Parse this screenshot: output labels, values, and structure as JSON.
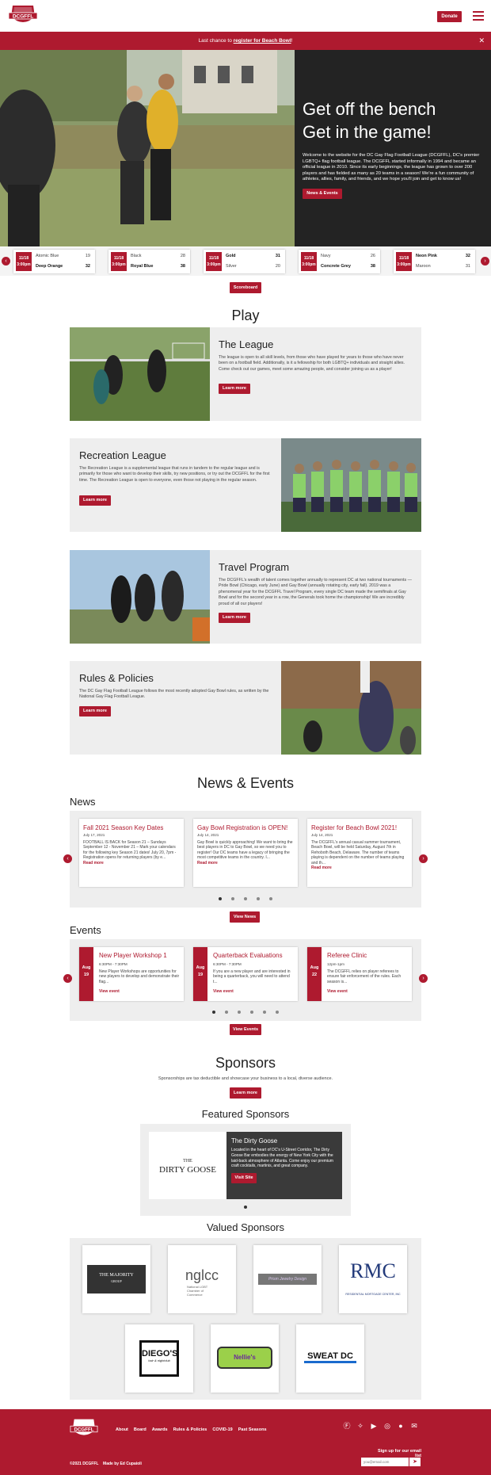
{
  "header": {
    "logo_text": "DCGFFL",
    "donate_label": "Donate"
  },
  "alert": {
    "prefix": "Last chance to ",
    "link": "register for Beach Bowl",
    "suffix": "!"
  },
  "hero": {
    "line1": "Get off the bench",
    "line2": "Get in the game!",
    "body": "Welcome to the website for the DC Gay Flag Football League (DCGFFL), DC's premier LGBTQ+ flag football league. The DCGFFL started informally in 1994 and became an official league in 2010. Since its early beginnings, the league has grown to over 200 players and has fielded as many as 20 teams in a season! We're a fun community of athletes, allies, family, and friends, and we hope you'll join and get to know us!",
    "button": "News & Events"
  },
  "scores": [
    {
      "date": "11/18",
      "time": "3:00pm",
      "t1": "Atomic Blue",
      "s1": "19",
      "t2": "Deep Orange",
      "s2": "32",
      "w": 2
    },
    {
      "date": "11/18",
      "time": "3:00pm",
      "t1": "Black",
      "s1": "28",
      "t2": "Royal Blue",
      "s2": "38",
      "w": 2
    },
    {
      "date": "11/18",
      "time": "3:00pm",
      "t1": "Gold",
      "s1": "31",
      "t2": "Silver",
      "s2": "20",
      "w": 1
    },
    {
      "date": "11/18",
      "time": "3:00pm",
      "t1": "Navy",
      "s1": "26",
      "t2": "Concrete Grey",
      "s2": "38",
      "w": 2
    },
    {
      "date": "11/18",
      "time": "3:00pm",
      "t1": "Neon Pink",
      "s1": "32",
      "t2": "Maroon",
      "s2": "31",
      "w": 1
    }
  ],
  "scoreboard_button": "Scoreboard",
  "play": {
    "title": "Play",
    "cards": [
      {
        "title": "The League",
        "body": "The league is open to all skill levels, from those who have played for years to those who have never been on a football field. Additionally, is it a fellowship for both LGBTQ+ individuals and straight allies. Come check out our games, meet some amazing people, and consider joining us as a player!",
        "button": "Learn more"
      },
      {
        "title": "Recreation League",
        "body": "The Recreation League is a supplemental league that runs in tandem to the regular league and is primarily for those who want to develop their skills, try new positions, or try out the DCGFFL for the first time. The Recreation League is open to everyone, even those not playing in the regular season.",
        "button": "Learn more"
      },
      {
        "title": "Travel Program",
        "body": "The DCGFFL's wealth of talent comes together annually to represent DC at two national tournaments — Pride Bowl (Chicago, early June) and Gay Bowl (annually rotating city, early fall). 2019 was a phenomenal year for the DCGFFL Travel Program, every single DC team made the semifinals at Gay Bowl and for the second year in a row, the Generals took home the championship! We are incredibly proud of all our players!",
        "button": "Learn more"
      },
      {
        "title": "Rules & Policies",
        "body": "The DC Gay Flag Football League follows the most recently adopted Gay Bowl rules, as written by the National Gay Flag Football League.",
        "button": "Learn more"
      }
    ]
  },
  "news_events": {
    "title": "News & Events",
    "news_heading": "News",
    "news": [
      {
        "title": "Fall 2021 Season Key Dates",
        "date": "July 17, 2021",
        "body": "FOOTBALL IS BACK for Season 21 – Sundays September 12 - November 21 – Mark your calendars for the following key Season 21 dates! July 20, 7pm - Registration opens for returning players (by e...",
        "more": "Read more"
      },
      {
        "title": "Gay Bowl Registration is OPEN!",
        "date": "July 14, 2021",
        "body": "Gay Bowl is quickly approaching! We want to bring the best players in DC to Gay Bowl, so we need you to register! Our DC teams have a legacy of bringing the most competitive teams in the country. I...",
        "more": "Read more"
      },
      {
        "title": "Register for Beach Bowl 2021!",
        "date": "July 14, 2021",
        "body": "The DCGFFL's annual casual summer tournament, Beach Bowl, will be held Saturday, August 7th in Rehoboth Beach, Delaware. The number of teams playing is dependent on the number of teams playing and th...",
        "more": "Read more"
      }
    ],
    "view_news": "View News",
    "events_heading": "Events",
    "events": [
      {
        "month": "Aug",
        "day": "19",
        "title": "New Player Workshop 1",
        "time": "6:30PM - 7:30PM",
        "body": "New Player Workshops are opportunities for new players to develop and demonstrate their flag...",
        "more": "View event"
      },
      {
        "month": "Aug",
        "day": "19",
        "title": "Quarterback Evaluations",
        "time": "6:30PM - 7:30PM",
        "body": "If you are a new player and are interested in being a quarterback, you will need to attend t...",
        "more": "View event"
      },
      {
        "month": "Aug",
        "day": "22",
        "title": "Referee Clinic",
        "time": "12pm-1pm",
        "body": "The DCGFFL relies on player referees to ensure fair enforcement of the rules. Each season is...",
        "more": "View event"
      }
    ],
    "view_events": "View Events"
  },
  "sponsors": {
    "title": "Sponsors",
    "tagline": "Sponsorships are tax deductible and showcase your business to a local, diverse audience.",
    "learn_more": "Learn more",
    "featured_heading": "Featured Sponsors",
    "featured": {
      "name": "The Dirty Goose",
      "logo": "DIRTY GOOSE",
      "logo_prefix": "THE",
      "body": "Located in the heart of DC's U-Street Corridor, The Dirty Goose Bar embodies the energy of New York City with the laid-back atmosphere of Atlanta. Come enjoy our premium craft cocktails, martinis, and great company.",
      "button": "Visit Site"
    },
    "valued_heading": "Valued Sponsors",
    "valued": [
      {
        "name": "THE MAJORITY",
        "sub": "GROUP"
      },
      {
        "name": "nglcc",
        "sub": "National LGBT Chamber of Commerce"
      },
      {
        "name": "Prism Jewelry Design",
        "sub": ""
      },
      {
        "name": "RMC",
        "sub": "RESIDENTIAL MORTGAGE CENTER, INC"
      },
      {
        "name": "DIEGO'S",
        "sub": "hair & nightclub"
      },
      {
        "name": "Nellie's",
        "sub": ""
      },
      {
        "name": "SWEAT DC",
        "sub": ""
      }
    ]
  },
  "footer": {
    "links": [
      "About",
      "Board",
      "Awards",
      "Rules & Policies",
      "COVID-19",
      "Past Seasons"
    ],
    "copyright": "©2021 DCGFFL",
    "credit": "Made by Ed Cupaioli",
    "signup": "Sign up for our email list",
    "email_placeholder": "you@email.com"
  },
  "colors": {
    "accent": "#ae1a2f",
    "dark": "#232323",
    "panel": "#eeeeee"
  }
}
